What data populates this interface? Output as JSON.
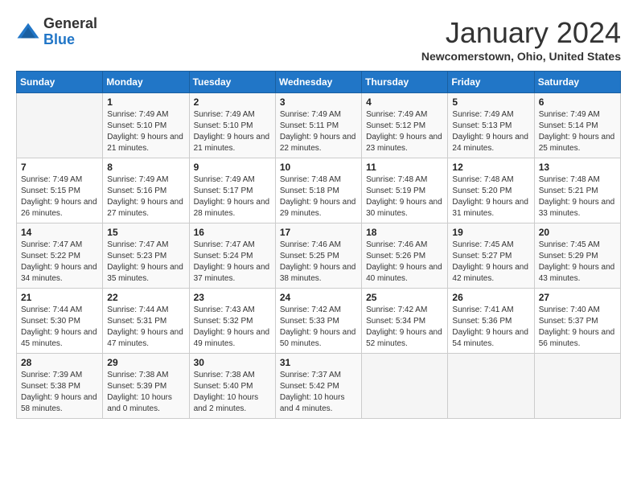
{
  "header": {
    "logo_general": "General",
    "logo_blue": "Blue",
    "month_title": "January 2024",
    "location": "Newcomerstown, Ohio, United States"
  },
  "days_of_week": [
    "Sunday",
    "Monday",
    "Tuesday",
    "Wednesday",
    "Thursday",
    "Friday",
    "Saturday"
  ],
  "weeks": [
    [
      {
        "day": "",
        "empty": true
      },
      {
        "day": "1",
        "sunrise": "7:49 AM",
        "sunset": "5:10 PM",
        "daylight": "9 hours and 21 minutes."
      },
      {
        "day": "2",
        "sunrise": "7:49 AM",
        "sunset": "5:10 PM",
        "daylight": "9 hours and 21 minutes."
      },
      {
        "day": "3",
        "sunrise": "7:49 AM",
        "sunset": "5:11 PM",
        "daylight": "9 hours and 22 minutes."
      },
      {
        "day": "4",
        "sunrise": "7:49 AM",
        "sunset": "5:12 PM",
        "daylight": "9 hours and 23 minutes."
      },
      {
        "day": "5",
        "sunrise": "7:49 AM",
        "sunset": "5:13 PM",
        "daylight": "9 hours and 24 minutes."
      },
      {
        "day": "6",
        "sunrise": "7:49 AM",
        "sunset": "5:14 PM",
        "daylight": "9 hours and 25 minutes."
      }
    ],
    [
      {
        "day": "7",
        "sunrise": "7:49 AM",
        "sunset": "5:15 PM",
        "daylight": "9 hours and 26 minutes."
      },
      {
        "day": "8",
        "sunrise": "7:49 AM",
        "sunset": "5:16 PM",
        "daylight": "9 hours and 27 minutes."
      },
      {
        "day": "9",
        "sunrise": "7:49 AM",
        "sunset": "5:17 PM",
        "daylight": "9 hours and 28 minutes."
      },
      {
        "day": "10",
        "sunrise": "7:48 AM",
        "sunset": "5:18 PM",
        "daylight": "9 hours and 29 minutes."
      },
      {
        "day": "11",
        "sunrise": "7:48 AM",
        "sunset": "5:19 PM",
        "daylight": "9 hours and 30 minutes."
      },
      {
        "day": "12",
        "sunrise": "7:48 AM",
        "sunset": "5:20 PM",
        "daylight": "9 hours and 31 minutes."
      },
      {
        "day": "13",
        "sunrise": "7:48 AM",
        "sunset": "5:21 PM",
        "daylight": "9 hours and 33 minutes."
      }
    ],
    [
      {
        "day": "14",
        "sunrise": "7:47 AM",
        "sunset": "5:22 PM",
        "daylight": "9 hours and 34 minutes."
      },
      {
        "day": "15",
        "sunrise": "7:47 AM",
        "sunset": "5:23 PM",
        "daylight": "9 hours and 35 minutes."
      },
      {
        "day": "16",
        "sunrise": "7:47 AM",
        "sunset": "5:24 PM",
        "daylight": "9 hours and 37 minutes."
      },
      {
        "day": "17",
        "sunrise": "7:46 AM",
        "sunset": "5:25 PM",
        "daylight": "9 hours and 38 minutes."
      },
      {
        "day": "18",
        "sunrise": "7:46 AM",
        "sunset": "5:26 PM",
        "daylight": "9 hours and 40 minutes."
      },
      {
        "day": "19",
        "sunrise": "7:45 AM",
        "sunset": "5:27 PM",
        "daylight": "9 hours and 42 minutes."
      },
      {
        "day": "20",
        "sunrise": "7:45 AM",
        "sunset": "5:29 PM",
        "daylight": "9 hours and 43 minutes."
      }
    ],
    [
      {
        "day": "21",
        "sunrise": "7:44 AM",
        "sunset": "5:30 PM",
        "daylight": "9 hours and 45 minutes."
      },
      {
        "day": "22",
        "sunrise": "7:44 AM",
        "sunset": "5:31 PM",
        "daylight": "9 hours and 47 minutes."
      },
      {
        "day": "23",
        "sunrise": "7:43 AM",
        "sunset": "5:32 PM",
        "daylight": "9 hours and 49 minutes."
      },
      {
        "day": "24",
        "sunrise": "7:42 AM",
        "sunset": "5:33 PM",
        "daylight": "9 hours and 50 minutes."
      },
      {
        "day": "25",
        "sunrise": "7:42 AM",
        "sunset": "5:34 PM",
        "daylight": "9 hours and 52 minutes."
      },
      {
        "day": "26",
        "sunrise": "7:41 AM",
        "sunset": "5:36 PM",
        "daylight": "9 hours and 54 minutes."
      },
      {
        "day": "27",
        "sunrise": "7:40 AM",
        "sunset": "5:37 PM",
        "daylight": "9 hours and 56 minutes."
      }
    ],
    [
      {
        "day": "28",
        "sunrise": "7:39 AM",
        "sunset": "5:38 PM",
        "daylight": "9 hours and 58 minutes."
      },
      {
        "day": "29",
        "sunrise": "7:38 AM",
        "sunset": "5:39 PM",
        "daylight": "10 hours and 0 minutes."
      },
      {
        "day": "30",
        "sunrise": "7:38 AM",
        "sunset": "5:40 PM",
        "daylight": "10 hours and 2 minutes."
      },
      {
        "day": "31",
        "sunrise": "7:37 AM",
        "sunset": "5:42 PM",
        "daylight": "10 hours and 4 minutes."
      },
      {
        "day": "",
        "empty": true
      },
      {
        "day": "",
        "empty": true
      },
      {
        "day": "",
        "empty": true
      }
    ]
  ],
  "labels": {
    "sunrise": "Sunrise:",
    "sunset": "Sunset:",
    "daylight": "Daylight:"
  }
}
